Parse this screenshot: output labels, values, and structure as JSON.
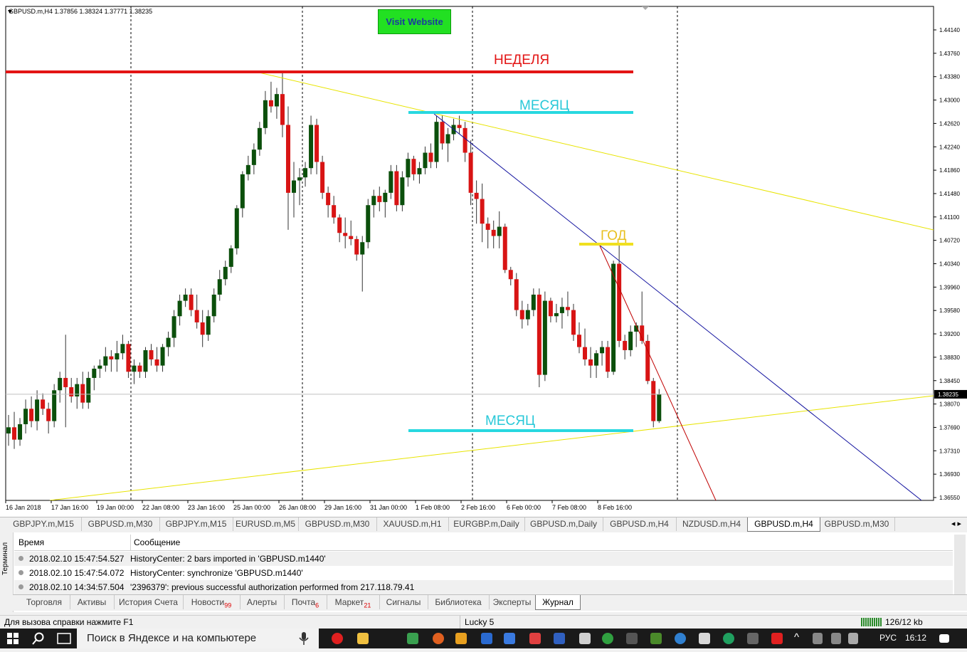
{
  "chart": {
    "symbol_info": "GBPUSD.m,H4  1.37856 1.38324 1.37771 1.38235",
    "visit_button": "Visit Website",
    "current_price": "1.38235",
    "price_labels": [
      "1.44140",
      "1.43760",
      "1.43380",
      "1.43000",
      "1.42620",
      "1.42240",
      "1.41860",
      "1.41480",
      "1.41100",
      "1.40720",
      "1.40340",
      "1.39960",
      "1.39580",
      "1.39200",
      "1.38830",
      "1.38450",
      "1.38070",
      "1.37690",
      "1.37310",
      "1.36930",
      "1.36550"
    ],
    "time_labels": [
      "16 Jan 2018",
      "17 Jan 16:00",
      "19 Jan 00:00",
      "22 Jan 08:00",
      "23 Jan 16:00",
      "25 Jan 00:00",
      "26 Jan 08:00",
      "29 Jan 16:00",
      "31 Jan 00:00",
      "1 Feb 08:00",
      "2 Feb 16:00",
      "6 Feb 00:00",
      "7 Feb 08:00",
      "8 Feb 16:00"
    ],
    "annotations": {
      "week": "НЕДЕЛЯ",
      "month_top": "МЕСЯЦ",
      "month_bottom": "МЕСЯЦ",
      "year": "ГОД"
    },
    "colors": {
      "bull": "#0b4f0b",
      "bear": "#d81414",
      "week_line": "#e31414",
      "month_line": "#28d8e0",
      "year_line": "#f0e020",
      "trend_yellow": "#e8e400",
      "trend_blue": "#1414a0",
      "trend_red": "#c00000"
    },
    "candles": [
      [
        1.376,
        1.379,
        1.374,
        1.377
      ],
      [
        1.377,
        1.3795,
        1.3735,
        1.375
      ],
      [
        1.375,
        1.3785,
        1.374,
        1.3775
      ],
      [
        1.3775,
        1.3815,
        1.376,
        1.38
      ],
      [
        1.38,
        1.382,
        1.377,
        1.378
      ],
      [
        1.378,
        1.383,
        1.3765,
        1.3815
      ],
      [
        1.3815,
        1.3825,
        1.379,
        1.38
      ],
      [
        1.38,
        1.381,
        1.376,
        1.378
      ],
      [
        1.378,
        1.384,
        1.377,
        1.383
      ],
      [
        1.383,
        1.386,
        1.381,
        1.385
      ],
      [
        1.385,
        1.392,
        1.377,
        1.3835
      ],
      [
        1.3835,
        1.385,
        1.381,
        1.382
      ],
      [
        1.382,
        1.385,
        1.38,
        1.384
      ],
      [
        1.384,
        1.386,
        1.38,
        1.381
      ],
      [
        1.381,
        1.386,
        1.38,
        1.385
      ],
      [
        1.385,
        1.387,
        1.383,
        1.3865
      ],
      [
        1.3865,
        1.388,
        1.385,
        1.387
      ],
      [
        1.387,
        1.39,
        1.386,
        1.3885
      ],
      [
        1.3885,
        1.3895,
        1.386,
        1.388
      ],
      [
        1.388,
        1.391,
        1.386,
        1.389
      ],
      [
        1.389,
        1.392,
        1.388,
        1.3905
      ],
      [
        1.3905,
        1.391,
        1.385,
        1.386
      ],
      [
        1.386,
        1.388,
        1.384,
        1.387
      ],
      [
        1.387,
        1.3875,
        1.385,
        1.386
      ],
      [
        1.386,
        1.39,
        1.385,
        1.3895
      ],
      [
        1.3895,
        1.3905,
        1.387,
        1.388
      ],
      [
        1.388,
        1.39,
        1.386,
        1.387
      ],
      [
        1.387,
        1.3905,
        1.386,
        1.39
      ],
      [
        1.39,
        1.3925,
        1.3885,
        1.3915
      ],
      [
        1.3915,
        1.396,
        1.39,
        1.395
      ],
      [
        1.395,
        1.3985,
        1.3935,
        1.3975
      ],
      [
        1.3975,
        1.3995,
        1.3965,
        1.3985
      ],
      [
        1.3985,
        1.3995,
        1.395,
        1.396
      ],
      [
        1.396,
        1.3985,
        1.393,
        1.394
      ],
      [
        1.394,
        1.396,
        1.39,
        1.392
      ],
      [
        1.392,
        1.396,
        1.391,
        1.395
      ],
      [
        1.395,
        1.3995,
        1.394,
        1.3985
      ],
      [
        1.3985,
        1.4025,
        1.3975,
        1.401
      ],
      [
        1.401,
        1.404,
        1.4,
        1.403
      ],
      [
        1.403,
        1.4065,
        1.402,
        1.406
      ],
      [
        1.406,
        1.413,
        1.405,
        1.4125
      ],
      [
        1.4125,
        1.4185,
        1.411,
        1.418
      ],
      [
        1.418,
        1.421,
        1.417,
        1.4195
      ],
      [
        1.4195,
        1.423,
        1.418,
        1.422
      ],
      [
        1.422,
        1.4265,
        1.421,
        1.4255
      ],
      [
        1.4255,
        1.4315,
        1.4245,
        1.43
      ],
      [
        1.43,
        1.433,
        1.428,
        1.429
      ],
      [
        1.429,
        1.432,
        1.427,
        1.431
      ],
      [
        1.431,
        1.4345,
        1.424,
        1.426
      ],
      [
        1.426,
        1.429,
        1.409,
        1.415
      ],
      [
        1.415,
        1.42,
        1.411,
        1.417
      ],
      [
        1.417,
        1.419,
        1.413,
        1.4175
      ],
      [
        1.4175,
        1.42,
        1.416,
        1.419
      ],
      [
        1.419,
        1.4275,
        1.418,
        1.426
      ],
      [
        1.426,
        1.427,
        1.418,
        1.42
      ],
      [
        1.42,
        1.421,
        1.414,
        1.415
      ],
      [
        1.415,
        1.416,
        1.411,
        1.413
      ],
      [
        1.413,
        1.4145,
        1.41,
        1.411
      ],
      [
        1.411,
        1.4115,
        1.407,
        1.4085
      ],
      [
        1.4085,
        1.411,
        1.406,
        1.408
      ],
      [
        1.408,
        1.4105,
        1.4065,
        1.4075
      ],
      [
        1.4075,
        1.408,
        1.404,
        1.405
      ],
      [
        1.405,
        1.408,
        1.399,
        1.407
      ],
      [
        1.407,
        1.414,
        1.406,
        1.413
      ],
      [
        1.413,
        1.4155,
        1.411,
        1.4145
      ],
      [
        1.4145,
        1.416,
        1.412,
        1.4135
      ],
      [
        1.4135,
        1.4155,
        1.411,
        1.415
      ],
      [
        1.415,
        1.4195,
        1.414,
        1.4185
      ],
      [
        1.4185,
        1.4195,
        1.412,
        1.413
      ],
      [
        1.413,
        1.4185,
        1.412,
        1.4175
      ],
      [
        1.4175,
        1.4215,
        1.416,
        1.4205
      ],
      [
        1.4205,
        1.421,
        1.417,
        1.418
      ],
      [
        1.418,
        1.42,
        1.4165,
        1.419
      ],
      [
        1.419,
        1.4225,
        1.418,
        1.4215
      ],
      [
        1.4215,
        1.423,
        1.419,
        1.42
      ],
      [
        1.42,
        1.4275,
        1.419,
        1.4265
      ],
      [
        1.4265,
        1.4275,
        1.422,
        1.423
      ],
      [
        1.423,
        1.4255,
        1.42,
        1.4245
      ],
      [
        1.4245,
        1.427,
        1.4235,
        1.426
      ],
      [
        1.426,
        1.4275,
        1.4245,
        1.4255
      ],
      [
        1.4255,
        1.4265,
        1.42,
        1.4215
      ],
      [
        1.4215,
        1.4235,
        1.413,
        1.415
      ],
      [
        1.415,
        1.417,
        1.41,
        1.414
      ],
      [
        1.414,
        1.4165,
        1.407,
        1.41
      ],
      [
        1.41,
        1.411,
        1.406,
        1.409
      ],
      [
        1.409,
        1.4105,
        1.406,
        1.408
      ],
      [
        1.408,
        1.412,
        1.406,
        1.4095
      ],
      [
        1.4095,
        1.41,
        1.402,
        1.4025
      ],
      [
        1.4025,
        1.403,
        1.4,
        1.401
      ],
      [
        1.401,
        1.402,
        1.395,
        1.396
      ],
      [
        1.396,
        1.3975,
        1.393,
        1.3945
      ],
      [
        1.3945,
        1.397,
        1.3935,
        1.396
      ],
      [
        1.396,
        1.3995,
        1.395,
        1.3985
      ],
      [
        1.3985,
        1.3995,
        1.3835,
        1.3855
      ],
      [
        1.3855,
        1.399,
        1.3845,
        1.3975
      ],
      [
        1.3975,
        1.398,
        1.394,
        1.395
      ],
      [
        1.395,
        1.397,
        1.394,
        1.3955
      ],
      [
        1.3955,
        1.398,
        1.393,
        1.3965
      ],
      [
        1.3965,
        1.399,
        1.395,
        1.396
      ],
      [
        1.396,
        1.397,
        1.391,
        1.392
      ],
      [
        1.392,
        1.394,
        1.389,
        1.39
      ],
      [
        1.39,
        1.393,
        1.387,
        1.388
      ],
      [
        1.388,
        1.39,
        1.385,
        1.387
      ],
      [
        1.387,
        1.3895,
        1.385,
        1.389
      ],
      [
        1.389,
        1.391,
        1.387,
        1.39
      ],
      [
        1.39,
        1.391,
        1.385,
        1.386
      ],
      [
        1.386,
        1.404,
        1.3855,
        1.4035
      ],
      [
        1.4035,
        1.4065,
        1.39,
        1.391
      ],
      [
        1.391,
        1.392,
        1.388,
        1.3895
      ],
      [
        1.3895,
        1.3935,
        1.3885,
        1.3925
      ],
      [
        1.3925,
        1.394,
        1.39,
        1.3935
      ],
      [
        1.3935,
        1.399,
        1.3905,
        1.391
      ],
      [
        1.391,
        1.392,
        1.384,
        1.3845
      ],
      [
        1.3845,
        1.385,
        1.377,
        1.378
      ],
      [
        1.378,
        1.3832,
        1.3777,
        1.3824
      ]
    ]
  },
  "chart_tabs": [
    "GBPJPY.m,M15",
    "GBPUSD.m,M30",
    "GBPJPY.m,M15",
    "EURUSD.m,M5",
    "GBPUSD.m,M30",
    "XAUUSD.m,H1",
    "EURGBP.m,Daily",
    "GBPUSD.m,Daily",
    "GBPUSD.m,H4",
    "NZDUSD.m,H4",
    "GBPUSD.m,H4",
    "GBPUSD.m,M30"
  ],
  "terminal": {
    "side_label": "Терминал",
    "col_time": "Время",
    "col_message": "Сообщение",
    "rows": [
      {
        "time": "2018.02.10 15:47:54.527",
        "msg": "HistoryCenter: 2 bars imported in 'GBPUSD.m1440'"
      },
      {
        "time": "2018.02.10 15:47:54.072",
        "msg": "HistoryCenter: synchronize 'GBPUSD.m1440'"
      },
      {
        "time": "2018.02.10 14:34:57.504",
        "msg": "'2396379': previous successful authorization performed from 217.118.79.41"
      }
    ],
    "tabs": [
      {
        "label": "Торговля",
        "badge": ""
      },
      {
        "label": "Активы",
        "badge": ""
      },
      {
        "label": "История Счета",
        "badge": ""
      },
      {
        "label": "Новости",
        "badge": "99"
      },
      {
        "label": "Алерты",
        "badge": ""
      },
      {
        "label": "Почта",
        "badge": "6"
      },
      {
        "label": "Маркет",
        "badge": "21"
      },
      {
        "label": "Сигналы",
        "badge": ""
      },
      {
        "label": "Библиотека",
        "badge": ""
      },
      {
        "label": "Эксперты",
        "badge": ""
      },
      {
        "label": "Журнал",
        "badge": ""
      }
    ]
  },
  "status": {
    "help": "Для вызова справки нажмите F1",
    "profile": "Lucky 5",
    "traffic": "126/12 kb"
  },
  "taskbar": {
    "search": "Поиск в Яндексе и на компьютере",
    "lang": "РУС",
    "time": "16:12"
  }
}
